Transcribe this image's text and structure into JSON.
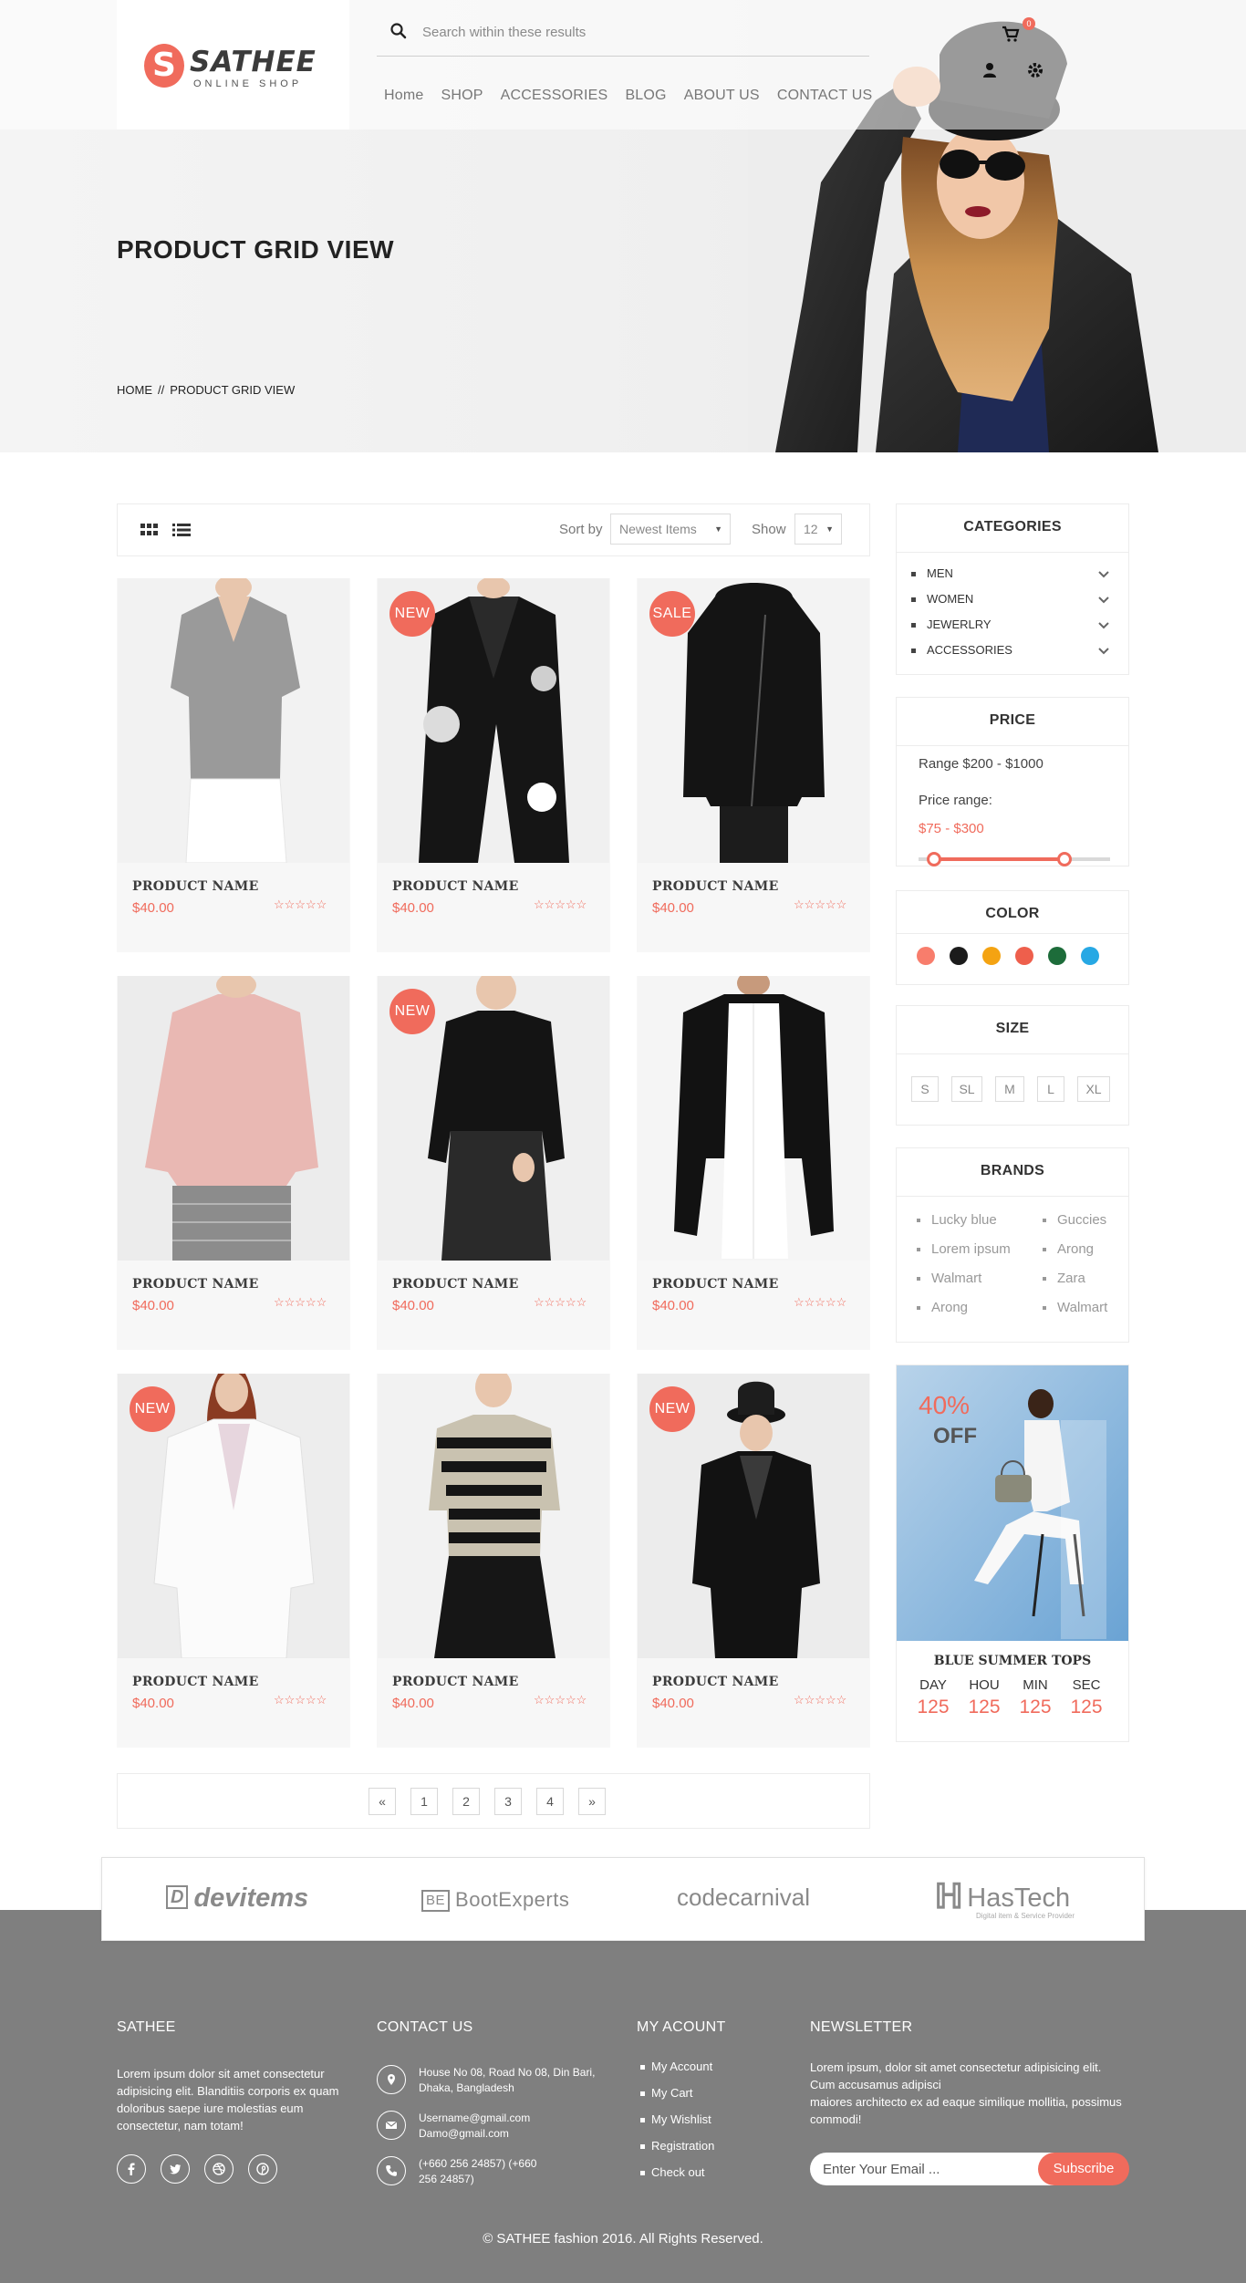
{
  "header": {
    "logo_letter": "S",
    "logo_name": "SATHEE",
    "logo_tagline": "ONLINE SHOP",
    "search_placeholder": "Search within these results",
    "cart_count": "0",
    "nav": [
      "Home",
      "SHOP",
      "ACCESSORIES",
      "BLOG",
      "ABOUT US",
      "CONTACT US"
    ]
  },
  "hero": {
    "title": "PRODUCT GRID VIEW",
    "breadcrumb": [
      "HOME",
      "//",
      "PRODUCT GRID VIEW"
    ]
  },
  "toolbar": {
    "sort_label": "Sort by",
    "sort_value": "Newest Items",
    "show_label": "Show",
    "show_value": "12"
  },
  "products": [
    {
      "name": "PRODUCT NAME",
      "price": "$40.00",
      "badge": "",
      "rating": "☆☆☆☆☆"
    },
    {
      "name": "PRODUCT NAME",
      "price": "$40.00",
      "badge": "NEW",
      "rating": "☆☆☆☆☆"
    },
    {
      "name": "PRODUCT NAME",
      "price": "$40.00",
      "badge": "SALE",
      "rating": "☆☆☆☆☆"
    },
    {
      "name": "PRODUCT NAME",
      "price": "$40.00",
      "badge": "",
      "rating": "☆☆☆☆☆"
    },
    {
      "name": "PRODUCT NAME",
      "price": "$40.00",
      "badge": "NEW",
      "rating": "☆☆☆☆☆"
    },
    {
      "name": "PRODUCT NAME",
      "price": "$40.00",
      "badge": "",
      "rating": "☆☆☆☆☆"
    },
    {
      "name": "PRODUCT NAME",
      "price": "$40.00",
      "badge": "NEW",
      "rating": "☆☆☆☆☆"
    },
    {
      "name": "PRODUCT NAME",
      "price": "$40.00",
      "badge": "",
      "rating": "☆☆☆☆☆"
    },
    {
      "name": "PRODUCT NAME",
      "price": "$40.00",
      "badge": "NEW",
      "rating": "☆☆☆☆☆"
    }
  ],
  "pagination": [
    "«",
    "1",
    "2",
    "3",
    "4",
    "»"
  ],
  "sidebar": {
    "categories": {
      "title": "CATEGORIES",
      "items": [
        "MEN",
        "WOMEN",
        "JEWERLRY",
        "ACCESSORIES"
      ]
    },
    "price": {
      "title": "PRICE",
      "range": "Range $200 - $1000",
      "label": "Price range:",
      "value": "$75 - $300",
      "slider_low": 0.08,
      "slider_high": 0.76
    },
    "color": {
      "title": "COLOR",
      "swatches": [
        "#f87d6c",
        "#1b1b1b",
        "#f4a312",
        "#ee5f4c",
        "#1d6c3a",
        "#27a8e4"
      ]
    },
    "size": {
      "title": "SIZE",
      "options": [
        "S",
        "SL",
        "M",
        "L",
        "XL"
      ]
    },
    "brands": {
      "title": "BRANDS",
      "left": [
        "Lucky blue",
        "Lorem ipsum",
        "Walmart",
        "Arong"
      ],
      "right": [
        "Guccies",
        "Arong",
        "Zara",
        "Walmart"
      ]
    },
    "promo": {
      "percent": "40%",
      "off": "OFF",
      "title": "BLUE SUMMER TOPS",
      "countdown": [
        {
          "label": "DAY",
          "value": "125"
        },
        {
          "label": "HOU",
          "value": "125"
        },
        {
          "label": "MIN",
          "value": "125"
        },
        {
          "label": "SEC",
          "value": "125"
        }
      ]
    }
  },
  "brand_logos": [
    "devitems",
    "BootExperts",
    "codecarnival",
    "HasTech"
  ],
  "brand_logo_prefix": {
    "devitems": "D",
    "bootexperts": "BE",
    "codecarnival_c": "C",
    "codecarnival_rest": "ode",
    "hastech_sub": "Digital item & Service Provider"
  },
  "footer": {
    "about_title": "SATHEE",
    "about_text": "Lorem ipsum dolor sit amet consectetur adipisicing elit. Blanditiis corporis ex quam doloribus saepe iure molestias eum consectetur, nam totam!",
    "contact_title": "CONTACT US",
    "contact": [
      {
        "icon": "map-pin-icon",
        "text": "House No 08, Road No 08, Din Bari, Dhaka, Bangladesh"
      },
      {
        "icon": "envelope-icon",
        "text": "Username@gmail.com Damo@gmail.com"
      },
      {
        "icon": "phone-icon",
        "text": "(+660 256 24857) (+660 256 24857)"
      }
    ],
    "account_title": "MY ACOUNT",
    "account_links": [
      "My Account",
      "My Cart",
      "My Wishlist",
      "Registration",
      "Check out"
    ],
    "newsletter_title": "NEWSLETTER",
    "newsletter_text_1": "Lorem ipsum, dolor sit amet consectetur adipisicing elit. Cum accusamus adipisci",
    "newsletter_text_2": "maiores architecto ex ad eaque similique mollitia, possimus commodi!",
    "email_placeholder": "Enter Your Email ...",
    "subscribe": "Subscribe",
    "copyright": "© SATHEE fashion 2016. All Rights Reserved."
  },
  "colors": {
    "accent": "#f06b5c",
    "footer_bg": "#7f7f7f"
  }
}
